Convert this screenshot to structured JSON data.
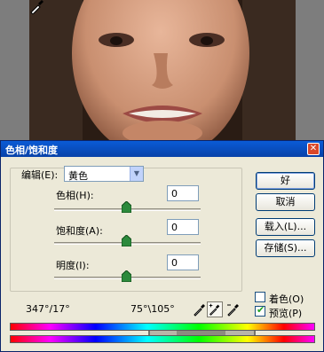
{
  "dialog": {
    "title": "色相/饱和度",
    "close_glyph": "✕"
  },
  "edit": {
    "label": "编辑(E):",
    "selected": "黄色"
  },
  "sliders": [
    {
      "label": "色相(H):",
      "value": "0"
    },
    {
      "label": "饱和度(A):",
      "value": "0"
    },
    {
      "label": "明度(I):",
      "value": "0"
    }
  ],
  "buttons": {
    "ok": "好",
    "cancel": "取消",
    "load": "载入(L)...",
    "save": "存储(S)..."
  },
  "checkboxes": {
    "colorize": {
      "label": "着色(O)",
      "checked": false
    },
    "preview": {
      "label": "预览(P)",
      "checked": true,
      "mark": "✔"
    }
  },
  "range": {
    "left": "347°/17°",
    "right": "75°\\105°"
  },
  "icons": [
    "eyedropper-icon",
    "eyedropper-plus-icon",
    "eyedropper-minus-icon",
    "close-icon",
    "chevron-down-icon",
    "cursor-icon"
  ],
  "colors": {
    "title_bar": "#0a4fc4",
    "dialog_bg": "#ece9d8",
    "slider_thumb": "#2c8a3c"
  }
}
